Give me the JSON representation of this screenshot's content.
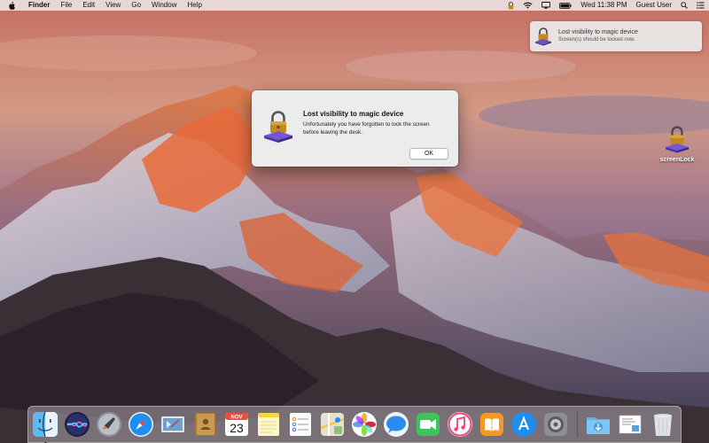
{
  "menubar": {
    "app_name": "Finder",
    "menus": [
      "File",
      "Edit",
      "View",
      "Go",
      "Window",
      "Help"
    ],
    "clock": "Wed 11:38 PM",
    "user": "Guest User"
  },
  "notification": {
    "title": "Lost visibility to magic device",
    "body": "Screen(s) should be locked now."
  },
  "alert": {
    "title": "Lost visibility to magic device",
    "body": "Unfortunately you have forgotten to lock the screen before leaving the desk.",
    "ok_label": "OK"
  },
  "desktop_icon": {
    "label": "screenLock"
  },
  "dock": {
    "calendar_month": "NOV",
    "calendar_day": "23",
    "items": [
      "finder-icon",
      "siri-icon",
      "launchpad-icon",
      "safari-icon",
      "mail-icon",
      "contacts-icon",
      "calendar-icon",
      "notes-icon",
      "reminders-icon",
      "maps-icon",
      "photos-icon",
      "messages-icon",
      "facetime-icon",
      "itunes-icon",
      "ibooks-icon",
      "app-store-icon",
      "system-preferences-icon",
      "downloads-folder-icon",
      "preview-icon",
      "trash-icon"
    ]
  },
  "colors": {
    "lock_gold": "#c08a1e",
    "lock_base_purple": "#6a4fc8",
    "accent_blue": "#1e8ef0"
  }
}
